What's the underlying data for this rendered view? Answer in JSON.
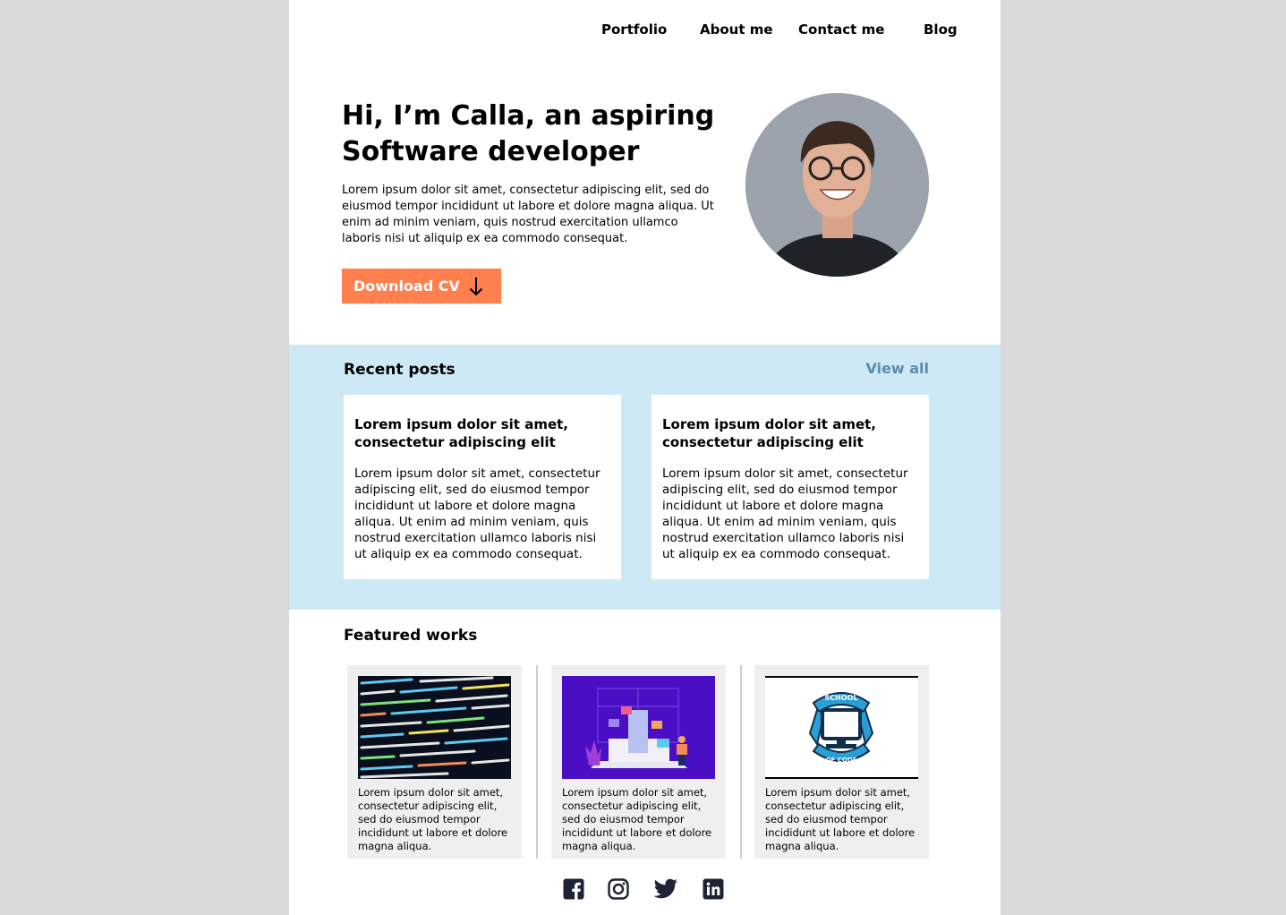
{
  "nav": {
    "items": [
      {
        "label": "Portfolio"
      },
      {
        "label": "About me"
      },
      {
        "label": "Contact me"
      },
      {
        "label": "Blog"
      }
    ]
  },
  "hero": {
    "title": "Hi, I’m Calla, an aspiring Software developer",
    "text": "Lorem ipsum dolor sit amet, consectetur adipiscing elit, sed do eiusmod tempor incididunt ut labore et dolore magna aliqua. Ut enim ad minim veniam, quis nostrud exercitation ullamco laboris nisi ut aliquip ex ea commodo consequat.",
    "button_label": "Download CV",
    "button_color": "#ff7f4f"
  },
  "recent_posts": {
    "heading": "Recent posts",
    "view_all": "View all",
    "background": "#cde9f6",
    "posts": [
      {
        "title": "Lorem ipsum dolor sit amet, consectetur adipiscing elit",
        "body": "Lorem ipsum dolor sit amet, consectetur adipiscing elit, sed do eiusmod tempor incididunt ut labore et dolore magna aliqua. Ut enim ad minim veniam, quis nostrud exercitation ullamco laboris nisi ut aliquip ex ea commodo consequat."
      },
      {
        "title": "Lorem ipsum dolor sit amet, consectetur adipiscing elit",
        "body": "Lorem ipsum dolor sit amet, consectetur adipiscing elit, sed do eiusmod tempor incididunt ut labore et dolore magna aliqua. Ut enim ad minim veniam, quis nostrud exercitation ullamco laboris nisi ut aliquip ex ea commodo consequat."
      }
    ]
  },
  "featured_works": {
    "heading": "Featured works",
    "works": [
      {
        "text": "Lorem ipsum dolor sit amet, consectetur adipiscing elit, sed do eiusmod tempor incididunt ut labore et dolore magna aliqua."
      },
      {
        "text": "Lorem ipsum dolor sit amet, consectetur adipiscing elit, sed do eiusmod tempor incididunt ut labore et dolore magna aliqua."
      },
      {
        "text": "Lorem ipsum dolor sit amet, consectetur adipiscing elit, sed do eiusmod tempor incididunt ut labore et dolore magna aliqua."
      }
    ],
    "logo": {
      "top_text": "SCHOOL",
      "bottom_text": "OF CODE"
    }
  },
  "social": {
    "icons": [
      "facebook-icon",
      "instagram-icon",
      "twitter-icon",
      "linkedin-icon"
    ],
    "color": "#1d2335"
  }
}
